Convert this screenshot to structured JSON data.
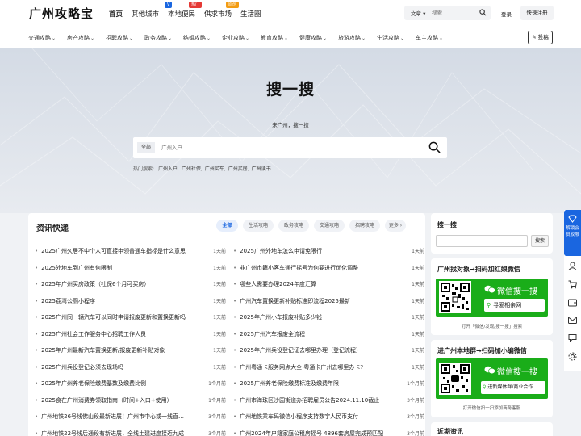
{
  "site": {
    "logo": "广州攻略宝"
  },
  "topnav": [
    {
      "label": "首页",
      "active": true
    },
    {
      "label": "其他城市",
      "badge": "V",
      "badge_color": "#1a66e0"
    },
    {
      "label": "本地便民",
      "badge": "热门",
      "badge_color": "#e53935"
    },
    {
      "label": "供求市场",
      "badge": "原创",
      "badge_color": "#f39c12"
    },
    {
      "label": "生活圈"
    }
  ],
  "search": {
    "type": "文章",
    "placeholder": "搜索"
  },
  "auth": {
    "login": "登录",
    "register": "快速注册"
  },
  "categories": [
    "交通攻略",
    "房产攻略",
    "招聘攻略",
    "政务攻略",
    "结婚攻略",
    "企业攻略",
    "教育攻略",
    "健康攻略",
    "旅游攻略",
    "生活攻略",
    "车主攻略"
  ],
  "post_button": "投稿",
  "hero": {
    "title": "搜一搜",
    "subtitle": "来广州，搜一搜",
    "all_label": "全部",
    "placeholder": "广州入户",
    "hot_label": "热门搜索:",
    "hot_terms": [
      "广州入户,",
      "广州社保,",
      "广州买车,",
      "广州买房,",
      "广州读书"
    ]
  },
  "news": {
    "title": "资讯快递",
    "tabs": [
      "全部",
      "生活攻略",
      "政务攻略",
      "交通攻略",
      "招聘攻略",
      "更多 ›"
    ],
    "left": [
      {
        "title": "2025广州久居不中个人可直接申领普通车指标是什么意思",
        "date": "1天前"
      },
      {
        "title": "2025外地车到广州有何限制",
        "date": "1天前"
      },
      {
        "title": "2025年广州买房政策（社保6个月可买房）",
        "date": "1天前"
      },
      {
        "title": "2025荔湾公厕小程序",
        "date": "1天前"
      },
      {
        "title": "2025广州同一辆汽车可以同时申请报废更新和置换更新吗",
        "date": "1天前"
      },
      {
        "title": "2025广州社会工作服务中心招聘工作人员",
        "date": "1天前"
      },
      {
        "title": "2025年广州最新汽车置换更新/报废更新补贴对象",
        "date": "1天前"
      },
      {
        "title": "2025广州兵役登记必须去现场吗",
        "date": "1天前"
      },
      {
        "title": "2025年广州养老保险缴费基数及缴费比例",
        "date": "1个月前"
      },
      {
        "title": "2025食在广州消费券领取指南（时间+入口+使用）",
        "date": "1个月前"
      },
      {
        "title": "广州地铁26号线佛山段最新进展！广州市中心或一线直…",
        "date": "3个月前"
      },
      {
        "title": "广州地铁22号线后通段有新进展，全线土建进度接近九成",
        "date": "3个月前"
      }
    ],
    "right": [
      {
        "title": "2025广州外地车怎么申请免限行",
        "date": "1天前"
      },
      {
        "title": "非广州市籍小客车通行摇号为何要进行优化调整",
        "date": "1天前"
      },
      {
        "title": "哪些人需要办理2024年度汇算",
        "date": "1天前"
      },
      {
        "title": "广州汽车置换更新补贴标准即流程2025最新",
        "date": "1天前"
      },
      {
        "title": "2025年广州小车报废补贴多少钱",
        "date": "1天前"
      },
      {
        "title": "2025广州汽车报废全流程",
        "date": "1天前"
      },
      {
        "title": "2025年广州兵役登记证去哪里办理（登记流程）",
        "date": "1天前"
      },
      {
        "title": "广州粤通卡服务网点大全 粤通卡广州去哪里办卡?",
        "date": "1天前"
      },
      {
        "title": "2025广州养老保险缴费标准及缴费年限",
        "date": "1个月前"
      },
      {
        "title": "广州市海珠区沙园街道办招聘雇员公告2024.11.10截止",
        "date": "3个月前"
      },
      {
        "title": "广州地铁乘车码微信小程序支持数字人民币支付",
        "date": "3个月前"
      },
      {
        "title": "广州2024年户籍家庭公租房摇号 4896套房屋完成预匹配",
        "date": "3个月前"
      }
    ]
  },
  "sidebar": {
    "search_title": "搜一搜",
    "search_button": "搜索",
    "card1": {
      "title": "广州找对象→扫码加红娘微信",
      "big": "微信搜一搜",
      "pill": "寻爱相亲网",
      "caption": "打开「微信/发现/搜一搜」搜索"
    },
    "card2": {
      "title": "进广州本地群→扫码加小编微信",
      "big": "微信搜一搜",
      "pill": "进新媒体群/商业合作",
      "caption": "打开微信扫一扫添加商务客服"
    },
    "recent_title": "近期资讯"
  },
  "float": {
    "vip": "解锁会员权限"
  },
  "colors": {
    "accent": "#1a66e0",
    "wechat": "#1aad19"
  }
}
